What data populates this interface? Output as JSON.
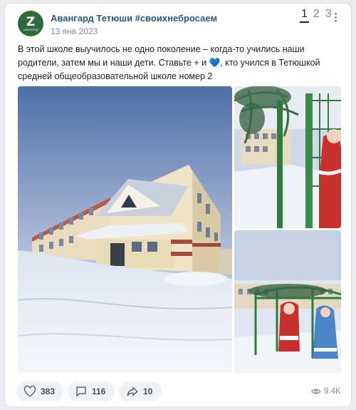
{
  "post": {
    "author": "Авангард Тетюши #своихнебросаем",
    "date": "13 янв 2023",
    "avatar_letter": "Z",
    "avatar_subtext": "АВАНГАРД",
    "text_before_heart": "В этой школе выучилось не одно поколение – когда-то учились наши родители, затем мы и наши дети. Ставьте + и ",
    "heart_emoji": "💙",
    "text_after_heart": ", кто учился в Тетюшкой средней общеобразовательной школе номер 2"
  },
  "pager": {
    "pages": [
      "1",
      "2",
      "3"
    ],
    "active": "1"
  },
  "actions": {
    "likes": "383",
    "comments": "116",
    "shares": "10",
    "views": "9.4K"
  },
  "colors": {
    "author_link": "#2a5885",
    "muted": "#818c99",
    "button_bg": "#f0f2f5",
    "avatar_bg": "#2f6a3c"
  },
  "icons": {
    "like": "heart-icon",
    "comment": "comment-icon",
    "share": "share-arrow-icon",
    "views": "eye-icon",
    "more": "more-dots-icon"
  }
}
